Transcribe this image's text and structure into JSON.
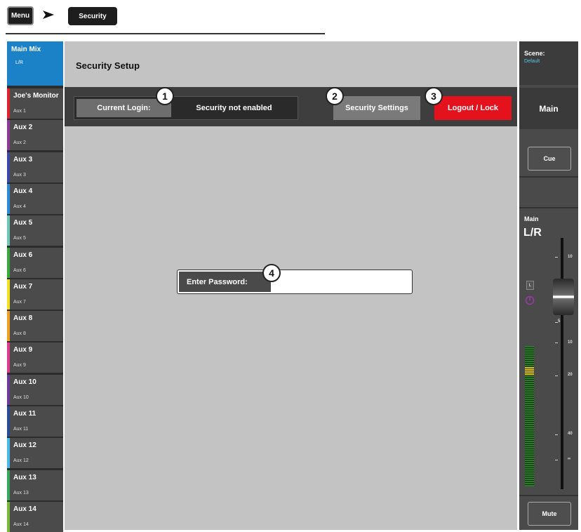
{
  "breadcrumb": {
    "menu_label": "Menu",
    "current_label": "Security"
  },
  "sidebar": {
    "main_mix": {
      "title": "Main Mix",
      "sub": "L/R",
      "color": "#1b82c8"
    },
    "items": [
      {
        "title": "Joe's Monitor",
        "sub": "Aux 1",
        "color": "#e0202a"
      },
      {
        "title": "Aux 2",
        "sub": "Aux 2",
        "color": "#8d3a96"
      },
      {
        "title": "Aux 3",
        "sub": "Aux 3",
        "color": "#3b4aa8"
      },
      {
        "title": "Aux 4",
        "sub": "Aux 4",
        "color": "#2a8ad8"
      },
      {
        "title": "Aux 5",
        "sub": "Aux 5",
        "color": "#6fc7b8"
      },
      {
        "title": "Aux 6",
        "sub": "Aux 6",
        "color": "#3aa83a"
      },
      {
        "title": "Aux 7",
        "sub": "Aux 7",
        "color": "#f0e020"
      },
      {
        "title": "Aux 8",
        "sub": "Aux 8",
        "color": "#f0a020"
      },
      {
        "title": "Aux 9",
        "sub": "Aux 9",
        "color": "#e03a8a"
      },
      {
        "title": "Aux 10",
        "sub": "Aux 10",
        "color": "#6a3a9a"
      },
      {
        "title": "Aux 11",
        "sub": "Aux 11",
        "color": "#2a4a9a"
      },
      {
        "title": "Aux 12",
        "sub": "Aux 12",
        "color": "#4ab8e8"
      },
      {
        "title": "Aux 13",
        "sub": "Aux 13",
        "color": "#3aa85a"
      },
      {
        "title": "Aux 14",
        "sub": "Aux 14",
        "color": "#7ab83a"
      }
    ]
  },
  "main": {
    "title": "Security Setup",
    "current_login_label": "Current Login:",
    "current_login_value": "Security not enabled",
    "security_settings_label": "Security Settings",
    "logout_label": "Logout / Lock",
    "enter_password_label": "Enter Password:",
    "password_value": ""
  },
  "callouts": [
    "1",
    "2",
    "3",
    "4"
  ],
  "right": {
    "scene_label": "Scene:",
    "scene_value": "Default",
    "main_label": "Main",
    "cue_label": "Cue",
    "channel_label": "Main",
    "channel_sub": "L/R",
    "l_indicator": "L",
    "fader_ticks": [
      "10",
      "5",
      "10",
      "20",
      "40",
      "∞"
    ],
    "mute_label": "Mute"
  },
  "colors": {
    "logout": "#e4121d",
    "main_mix": "#1b82c8",
    "scene_value": "#56c7e8"
  }
}
